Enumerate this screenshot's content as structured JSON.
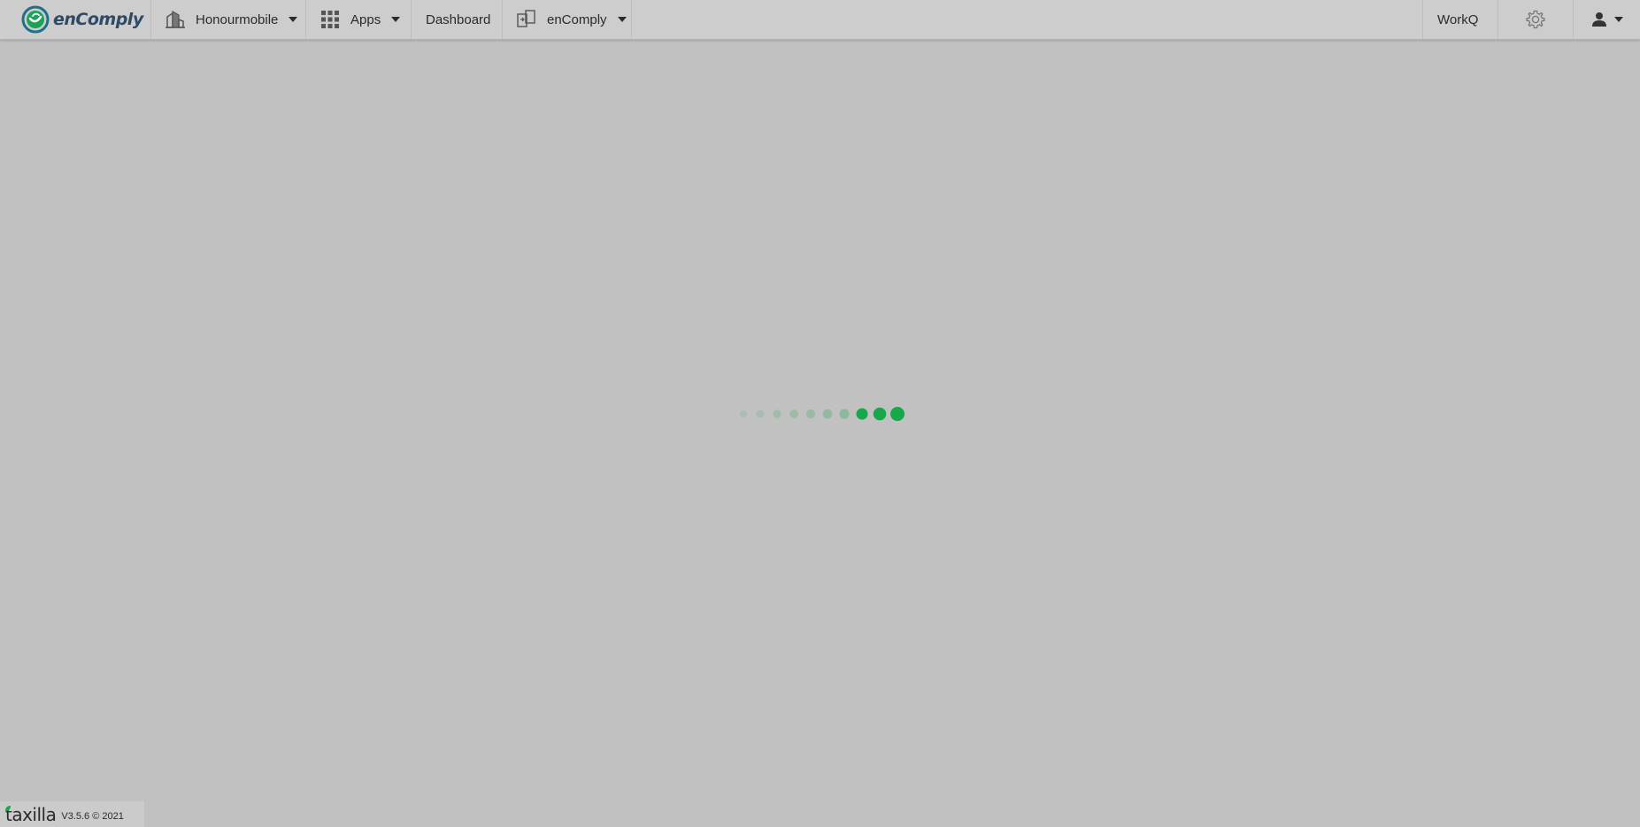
{
  "header": {
    "brand": "enComply",
    "org_name": "Honourmobile",
    "apps_label": "Apps",
    "dashboard_label": "Dashboard",
    "product_label": "enComply",
    "workq_label": "WorkQ"
  },
  "loader": {
    "active_color": "#17a84a",
    "faded_color": "#a9d2b4"
  },
  "footer": {
    "logo_text": "taxilla",
    "version_text": "V3.5.6 © 2021"
  },
  "icons": [
    "encomply-logo-icon",
    "building-icon",
    "grid-apps-icon",
    "switch-app-icon",
    "gear-icon",
    "user-icon"
  ]
}
